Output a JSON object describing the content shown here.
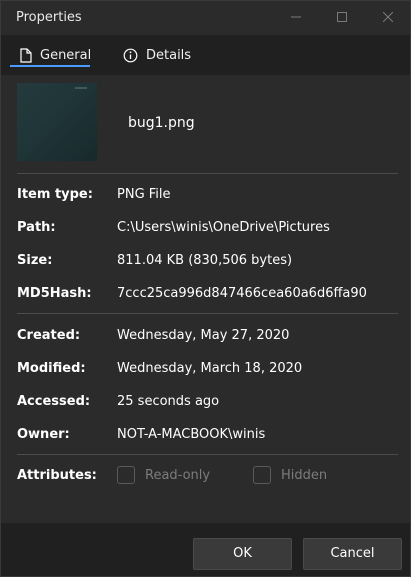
{
  "window": {
    "title": "Properties"
  },
  "tabs": [
    {
      "label": "General",
      "icon": "document-icon"
    },
    {
      "label": "Details",
      "icon": "info-icon"
    }
  ],
  "file": {
    "name": "bug1.png"
  },
  "properties": {
    "item_type": {
      "label": "Item type:",
      "value": "PNG File"
    },
    "path": {
      "label": "Path:",
      "value": "C:\\Users\\winis\\OneDrive\\Pictures"
    },
    "size": {
      "label": "Size:",
      "value": "811.04 KB (830,506 bytes)"
    },
    "md5": {
      "label": "MD5Hash:",
      "value": "7ccc25ca996d847466cea60a6d6ffa90"
    },
    "created": {
      "label": "Created:",
      "value": "Wednesday, May 27, 2020"
    },
    "modified": {
      "label": "Modified:",
      "value": "Wednesday, March 18, 2020"
    },
    "accessed": {
      "label": "Accessed:",
      "value": "25 seconds ago"
    },
    "owner": {
      "label": "Owner:",
      "value": "NOT-A-MACBOOK\\winis"
    }
  },
  "attributes": {
    "label": "Attributes:",
    "read_only": {
      "label": "Read-only",
      "checked": false
    },
    "hidden": {
      "label": "Hidden",
      "checked": false
    }
  },
  "buttons": {
    "ok": "OK",
    "cancel": "Cancel"
  },
  "colors": {
    "accent": "#4a9bff",
    "background": "#2b2b2b",
    "footer": "#202020"
  }
}
